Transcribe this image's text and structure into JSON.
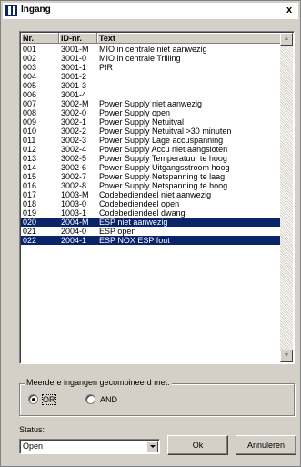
{
  "window": {
    "title": "Ingang",
    "close_glyph": "x",
    "icon": "app-icon"
  },
  "list": {
    "columns": [
      "Nr.",
      "ID-nr.",
      "Text"
    ],
    "rows": [
      {
        "nr": "001",
        "id": "3001-M",
        "text": "MIO in centrale niet aanwezig",
        "selected": false
      },
      {
        "nr": "002",
        "id": "3001-0",
        "text": "MIO in centrale Trilling",
        "selected": false
      },
      {
        "nr": "003",
        "id": "3001-1",
        "text": "PIR",
        "selected": false
      },
      {
        "nr": "004",
        "id": "3001-2",
        "text": "",
        "selected": false
      },
      {
        "nr": "005",
        "id": "3001-3",
        "text": "",
        "selected": false
      },
      {
        "nr": "006",
        "id": "3001-4",
        "text": "",
        "selected": false
      },
      {
        "nr": "007",
        "id": "3002-M",
        "text": "Power Supply niet aanwezig",
        "selected": false
      },
      {
        "nr": "008",
        "id": "3002-0",
        "text": "Power Supply open",
        "selected": false
      },
      {
        "nr": "009",
        "id": "3002-1",
        "text": "Power Supply Netuitval",
        "selected": false
      },
      {
        "nr": "010",
        "id": "3002-2",
        "text": "Power Supply Netuitval >30 minuten",
        "selected": false
      },
      {
        "nr": "011",
        "id": "3002-3",
        "text": "Power Supply Lage accuspanning",
        "selected": false
      },
      {
        "nr": "012",
        "id": "3002-4",
        "text": "Power Supply Accu niet aangsloten",
        "selected": false
      },
      {
        "nr": "013",
        "id": "3002-5",
        "text": "Power Supply Temperatuur te hoog",
        "selected": false
      },
      {
        "nr": "014",
        "id": "3002-6",
        "text": "Power Supply Uitgangsstroom hoog",
        "selected": false
      },
      {
        "nr": "015",
        "id": "3002-7",
        "text": "Power Supply Netspanning te laag",
        "selected": false
      },
      {
        "nr": "016",
        "id": "3002-8",
        "text": "Power Supply Netspanning te hoog",
        "selected": false
      },
      {
        "nr": "017",
        "id": "1003-M",
        "text": "Codebediendeel niet aanwezig",
        "selected": false
      },
      {
        "nr": "018",
        "id": "1003-0",
        "text": "Codebediendeel open",
        "selected": false
      },
      {
        "nr": "019",
        "id": "1003-1",
        "text": "Codebediendeel dwang",
        "selected": false
      },
      {
        "nr": "020",
        "id": "2004-M",
        "text": "ESP niet aanwezig",
        "selected": true
      },
      {
        "nr": "021",
        "id": "2004-0",
        "text": "ESP open",
        "selected": false
      },
      {
        "nr": "022",
        "id": "2004-1",
        "text": "ESP NOX ESP fout",
        "selected": true
      }
    ]
  },
  "combine_group": {
    "legend": "Meerdere ingangen gecombineerd met:",
    "options": [
      {
        "label": "OR",
        "checked": true
      },
      {
        "label": "AND",
        "checked": false
      }
    ]
  },
  "status": {
    "label": "Status:",
    "value": "Open"
  },
  "buttons": {
    "ok": "Ok",
    "cancel": "Annuleren"
  },
  "colors": {
    "selection": "#0a246a",
    "face": "#d4d0c8"
  }
}
